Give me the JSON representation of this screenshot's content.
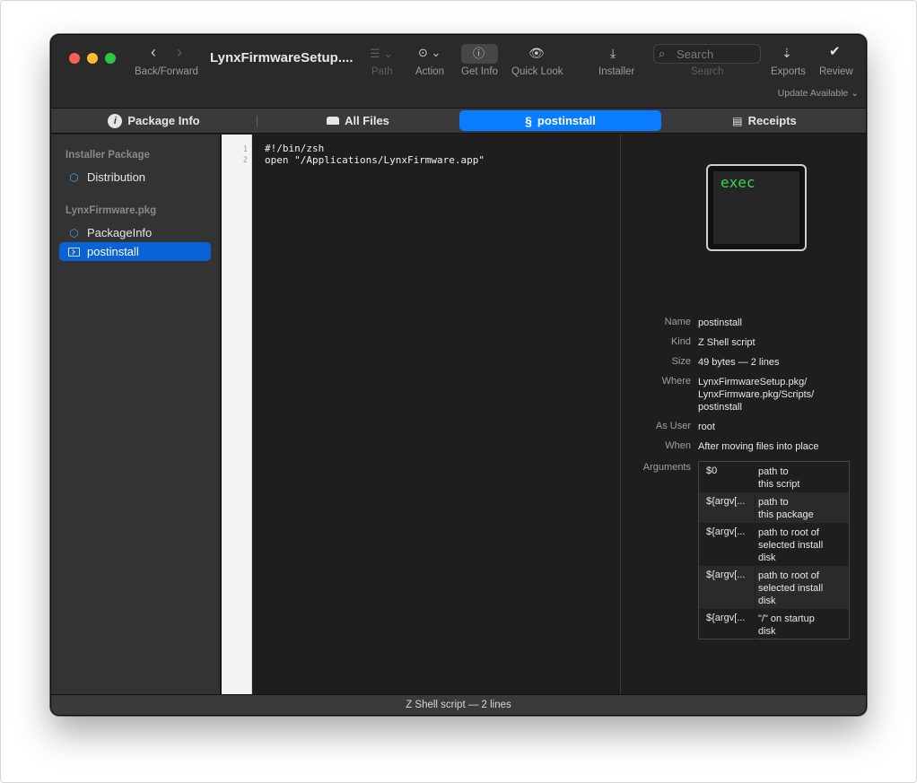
{
  "window": {
    "title": "LynxFirmwareSetup...."
  },
  "toolbar": {
    "back_forward_label": "Back/Forward",
    "path_label": "Path",
    "action_label": "Action",
    "get_info_label": "Get Info",
    "quick_look_label": "Quick Look",
    "installer_label": "Installer",
    "search_placeholder": "Search",
    "search_label": "Search",
    "exports_label": "Exports",
    "review_label": "Review",
    "update_available": "Update Available"
  },
  "tabs": [
    {
      "label": "Package Info",
      "icon": "info-icon",
      "active": false
    },
    {
      "label": "All Files",
      "icon": "disk-icon",
      "active": false
    },
    {
      "label": "postinstall",
      "icon": "script-icon",
      "active": true
    },
    {
      "label": "Receipts",
      "icon": "list-icon",
      "active": false
    }
  ],
  "sidebar": {
    "section1_header": "Installer Package",
    "item_distribution": "Distribution",
    "section2_header": "LynxFirmware.pkg",
    "item_packageinfo": "PackageInfo",
    "item_postinstall": "postinstall"
  },
  "code": {
    "line_numbers": [
      "1",
      "2"
    ],
    "lines": [
      "#!/bin/zsh",
      "open \"/Applications/LynxFirmware.app\""
    ]
  },
  "inspector": {
    "icon_text": "exec",
    "name_label": "Name",
    "name_value": "postinstall",
    "kind_label": "Kind",
    "kind_value": "Z Shell script",
    "size_label": "Size",
    "size_value": "49 bytes — 2 lines",
    "where_label": "Where",
    "where_line1": "LynxFirmwareSetup.pkg/",
    "where_line2": "LynxFirmware.pkg/Scripts/",
    "where_line3": "postinstall",
    "asuser_label": "As User",
    "asuser_value": "root",
    "when_label": "When",
    "when_value": "After moving files into place",
    "arguments_label": "Arguments",
    "arguments": [
      {
        "name": "$0",
        "desc1": "path to",
        "desc2": "this script",
        "desc3": ""
      },
      {
        "name": "${argv[...",
        "desc1": "path to",
        "desc2": "this package",
        "desc3": ""
      },
      {
        "name": "${argv[...",
        "desc1": "path to root of",
        "desc2": "selected install",
        "desc3": "disk"
      },
      {
        "name": "${argv[...",
        "desc1": "path to root of",
        "desc2": "selected install",
        "desc3": "disk"
      },
      {
        "name": "${argv[...",
        "desc1": "\"/\" on startup",
        "desc2": "disk",
        "desc3": ""
      }
    ]
  },
  "status": {
    "text": "Z Shell script — 2 lines"
  }
}
